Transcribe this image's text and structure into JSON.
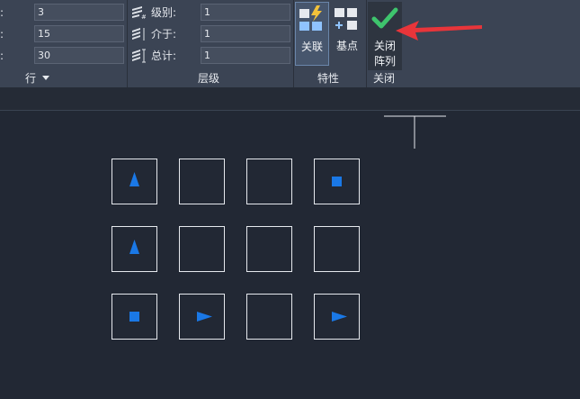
{
  "rows_panel": {
    "fields": [
      {
        "label": ":",
        "value": "3"
      },
      {
        "label": ":",
        "value": "15"
      },
      {
        "label": ":",
        "value": "30"
      }
    ],
    "title": "行"
  },
  "levels_panel": {
    "fields": [
      {
        "label": "级别:",
        "value": "1"
      },
      {
        "label": "介于:",
        "value": "1"
      },
      {
        "label": "总计:",
        "value": "1"
      }
    ],
    "title": "层级"
  },
  "properties_panel": {
    "associative_label": "关联",
    "basepoint_label": "基点",
    "title": "特性"
  },
  "close_panel": {
    "close_line1": "关闭",
    "close_line2": "阵列",
    "title": "关闭"
  },
  "colors": {
    "ribbon": "#3b4454",
    "canvas": "#222834",
    "accent_blue": "#1a78e6",
    "check_green": "#3ec46d",
    "annotation_red": "#e8353a"
  },
  "grid": [
    [
      "arrow-up",
      "empty",
      "empty",
      "square"
    ],
    [
      "arrow-up",
      "empty",
      "empty",
      "empty"
    ],
    [
      "square",
      "arrow-right",
      "empty",
      "arrow-right"
    ]
  ]
}
